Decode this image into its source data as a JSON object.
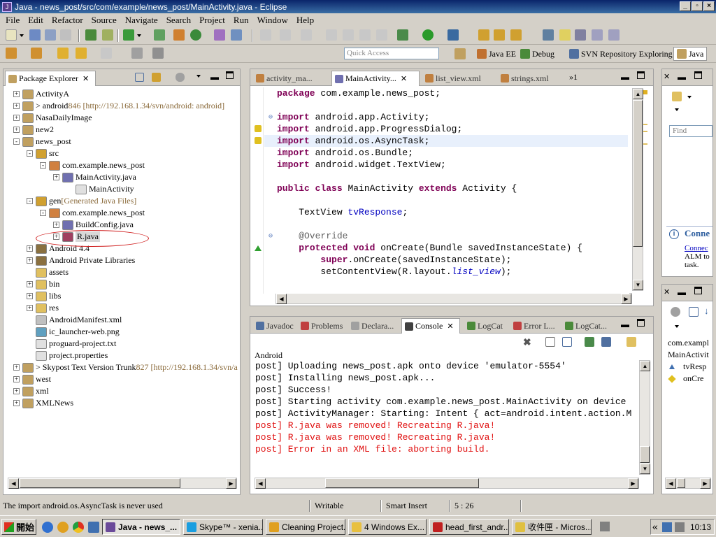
{
  "window": {
    "title": "Java - news_post/src/com/example/news_post/MainActivity.java - Eclipse"
  },
  "menu": [
    "File",
    "Edit",
    "Refactor",
    "Source",
    "Navigate",
    "Search",
    "Project",
    "Run",
    "Window",
    "Help"
  ],
  "quick_access": {
    "placeholder": "Quick Access"
  },
  "perspectives": [
    {
      "label": "Java EE"
    },
    {
      "label": "Debug"
    },
    {
      "label": "SVN Repository Exploring"
    },
    {
      "label": "Java",
      "selected": true
    }
  ],
  "package_explorer": {
    "tab_label": "Package Explorer",
    "items": [
      {
        "label": "ActivityA",
        "level": 0,
        "expander": "+",
        "kind": "project"
      },
      {
        "label": "> android",
        "decoration": " 846 [http://192.168.1.34/svn/android: android]",
        "level": 0,
        "expander": "+",
        "kind": "project-svn"
      },
      {
        "label": "NasaDailyImage",
        "level": 0,
        "expander": "+",
        "kind": "project"
      },
      {
        "label": "new2",
        "level": 0,
        "expander": "+",
        "kind": "project"
      },
      {
        "label": "news_post",
        "level": 0,
        "expander": "-",
        "kind": "project"
      },
      {
        "label": "src",
        "level": 1,
        "expander": "-",
        "kind": "srcfolder"
      },
      {
        "label": "com.example.news_post",
        "level": 2,
        "expander": "-",
        "kind": "package"
      },
      {
        "label": "MainActivity.java",
        "level": 3,
        "expander": "+",
        "kind": "java"
      },
      {
        "label": "MainActivity",
        "level": 4,
        "expander": "",
        "kind": "file"
      },
      {
        "label": "gen",
        "decoration": " [Generated Java Files]",
        "level": 1,
        "expander": "-",
        "kind": "genfolder"
      },
      {
        "label": "com.example.news_post",
        "level": 2,
        "expander": "-",
        "kind": "package"
      },
      {
        "label": "BuildConfig.java",
        "level": 3,
        "expander": "+",
        "kind": "java"
      },
      {
        "label": "R.java",
        "level": 3,
        "expander": "+",
        "kind": "java-err",
        "highlighted": true
      },
      {
        "label": "Android 4.4",
        "level": 1,
        "expander": "+",
        "kind": "library"
      },
      {
        "label": "Android Private Libraries",
        "level": 1,
        "expander": "+",
        "kind": "library"
      },
      {
        "label": "assets",
        "level": 1,
        "expander": "",
        "kind": "folder"
      },
      {
        "label": "bin",
        "level": 1,
        "expander": "+",
        "kind": "folder"
      },
      {
        "label": "libs",
        "level": 1,
        "expander": "+",
        "kind": "folder"
      },
      {
        "label": "res",
        "level": 1,
        "expander": "+",
        "kind": "folder"
      },
      {
        "label": "AndroidManifest.xml",
        "level": 1,
        "expander": "",
        "kind": "xml"
      },
      {
        "label": "ic_launcher-web.png",
        "level": 1,
        "expander": "",
        "kind": "image"
      },
      {
        "label": "proguard-project.txt",
        "level": 1,
        "expander": "",
        "kind": "file"
      },
      {
        "label": "project.properties",
        "level": 1,
        "expander": "",
        "kind": "file"
      },
      {
        "label": "> Skypost Text Version Trunk",
        "decoration": " 827 [http://192.168.1.34/svn/a",
        "level": 0,
        "expander": "+",
        "kind": "project-svn"
      },
      {
        "label": "west",
        "level": 0,
        "expander": "+",
        "kind": "project"
      },
      {
        "label": "xml",
        "level": 0,
        "expander": "+",
        "kind": "project-err"
      },
      {
        "label": "XMLNews",
        "level": 0,
        "expander": "+",
        "kind": "project"
      }
    ]
  },
  "editor": {
    "tabs": [
      {
        "label": "activity_ma..."
      },
      {
        "label": "MainActivity...",
        "selected": true
      },
      {
        "label": "list_view.xml"
      },
      {
        "label": "strings.xml"
      }
    ],
    "overflow": "»1",
    "lines": [
      [
        {
          "t": "package",
          "c": "kw"
        },
        {
          "t": " com.example.news_post;"
        }
      ],
      [],
      [
        {
          "t": "import",
          "c": "kw"
        },
        {
          "t": " android.app.Activity;"
        }
      ],
      [
        {
          "t": "import",
          "c": "kw"
        },
        {
          "t": " android.app.ProgressDialog;"
        }
      ],
      [
        {
          "t": "import",
          "c": "kw"
        },
        {
          "t": " android.os.AsyncTask;"
        }
      ],
      [
        {
          "t": "import",
          "c": "kw"
        },
        {
          "t": " android.os.Bundle;"
        }
      ],
      [
        {
          "t": "import",
          "c": "kw"
        },
        {
          "t": " android.widget.TextView;"
        }
      ],
      [],
      [
        {
          "t": "public",
          "c": "kw"
        },
        {
          "t": " "
        },
        {
          "t": "class",
          "c": "kw"
        },
        {
          "t": " MainActivity "
        },
        {
          "t": "extends",
          "c": "kw"
        },
        {
          "t": " Activity {"
        }
      ],
      [],
      [
        {
          "t": "    TextView "
        },
        {
          "t": "tvResponse",
          "c": "fld"
        },
        {
          "t": ";"
        }
      ],
      [],
      [
        {
          "t": "    @Override",
          "c": "ann"
        }
      ],
      [
        {
          "t": "    "
        },
        {
          "t": "protected",
          "c": "kw"
        },
        {
          "t": " "
        },
        {
          "t": "void",
          "c": "kw"
        },
        {
          "t": " onCreate(Bundle savedInstanceState) {"
        }
      ],
      [
        {
          "t": "        "
        },
        {
          "t": "super",
          "c": "kw"
        },
        {
          "t": ".onCreate(savedInstanceState);"
        }
      ],
      [
        {
          "t": "        setContentView(R.layout."
        },
        {
          "t": "list_view",
          "c": "it"
        },
        {
          "t": ");"
        }
      ]
    ]
  },
  "bottom_panel": {
    "tabs": [
      {
        "label": "Javadoc"
      },
      {
        "label": "Problems"
      },
      {
        "label": "Declara..."
      },
      {
        "label": "Console",
        "selected": true
      },
      {
        "label": "LogCat"
      },
      {
        "label": "Error L..."
      },
      {
        "label": "LogCat..."
      }
    ],
    "console_title": "Android",
    "lines": [
      {
        "text": "post] Uploading news_post.apk onto device 'emulator-5554'",
        "error": false
      },
      {
        "text": "post] Installing news_post.apk...",
        "error": false
      },
      {
        "text": "post] Success!",
        "error": false
      },
      {
        "text": "post] Starting activity com.example.news_post.MainActivity on device",
        "error": false
      },
      {
        "text": "post] ActivityManager: Starting: Intent { act=android.intent.action.M",
        "error": false
      },
      {
        "text": "post] R.java was removed! Recreating R.java!",
        "error": true
      },
      {
        "text": "post] R.java was removed! Recreating R.java!",
        "error": true
      },
      {
        "text": "post] Error in an XML file: aborting build.",
        "error": true
      }
    ]
  },
  "right_panel": {
    "find_placeholder": "Find",
    "connect_title": "Conne",
    "connect_link": "Connec",
    "connect_text1": "ALM to",
    "connect_text2": "task."
  },
  "outline": {
    "items": [
      {
        "label": "com.exampl"
      },
      {
        "label": "MainActivit"
      },
      {
        "label": "tvResp"
      },
      {
        "label": "onCre"
      }
    ]
  },
  "status": {
    "message": "The import android.os.AsyncTask is never used",
    "mode": "Writable",
    "insert": "Smart Insert",
    "position": "5 : 26"
  },
  "taskbar": {
    "start_label": "開始",
    "buttons": [
      {
        "label": "Java - news_...",
        "active": true,
        "color": "#6b4a9a"
      },
      {
        "label": "Skype™ - xenia...",
        "color": "#1a9ee0"
      },
      {
        "label": "Cleaning Project...",
        "color": "#e0a020"
      },
      {
        "label": "4 Windows Ex...",
        "color": "#e8c040"
      },
      {
        "label": "head_first_andr...",
        "color": "#c02020"
      },
      {
        "label": "收件匣 - Micros...",
        "color": "#e0c040"
      }
    ],
    "clock": "10:13",
    "chevron": "«"
  }
}
